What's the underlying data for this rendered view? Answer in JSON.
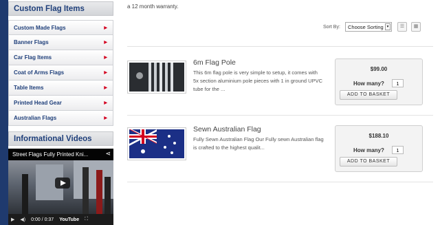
{
  "sidebar": {
    "flag_heading": "Custom Flag Items",
    "items": [
      {
        "label": "Custom Made Flags"
      },
      {
        "label": "Banner Flags"
      },
      {
        "label": "Car Flag Items"
      },
      {
        "label": "Coat of Arms Flags"
      },
      {
        "label": "Table Items"
      },
      {
        "label": "Printed Head Gear"
      },
      {
        "label": "Australian Flags"
      }
    ],
    "arrow": "▶",
    "video_heading": "Informational Videos"
  },
  "video": {
    "title": "Street Flags Fully Printed Kni...",
    "time": "0:00 / 0:37",
    "brand": "YouTube"
  },
  "main": {
    "warranty_text": "a 12 month warranty.",
    "sort_label": "Sort By:",
    "sort_value": "Choose Sorting"
  },
  "products": [
    {
      "name": "6m Flag Pole",
      "description": "This 6m flag pole is very simple to setup, it comes with 5x section aluminium pole pieces with 1 in ground UPVC tube for the ...",
      "price": "$99.00",
      "qty_label": "How many?",
      "qty": "1",
      "button": "ADD TO BASKET"
    },
    {
      "name": "Sewn Australian Flag",
      "description": "Fully Sewn Australian Flag      Our Fully sewn Australian flag is crafted to the highest qualit...",
      "price": "$188.10",
      "qty_label": "How many?",
      "qty": "1",
      "button": "ADD TO BASKET"
    }
  ]
}
